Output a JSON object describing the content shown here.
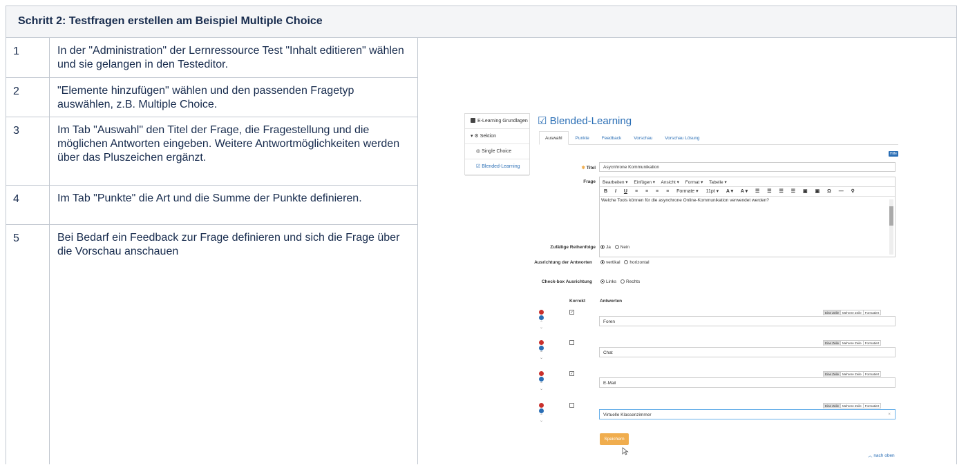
{
  "header": {
    "title": "Schritt 2: Testfragen erstellen am Beispiel Multiple Choice"
  },
  "steps": [
    {
      "num": "1",
      "text": "In der \"Administration\" der Lernressource Test  \"Inhalt editieren\" wählen und sie gelangen in den Testeditor."
    },
    {
      "num": "2",
      "text": "\"Elemente hinzufügen\" wählen und den passenden Fragetyp auswählen, z.B. Multiple Choice."
    },
    {
      "num": "3",
      "text": "Im Tab \"Auswahl\" den Titel der Frage, die Fragestellung und die möglichen Antworten eingeben. Weitere Antwortmöglichkeiten werden über das Pluszeichen ergänzt."
    },
    {
      "num": "4",
      "text": "Im Tab \"Punkte\" die Art und die Summe der Punkte definieren."
    },
    {
      "num": "5",
      "text": "Bei Bedarf ein Feedback zur Frage definieren und sich die Frage über die Vorschau anschauen"
    }
  ],
  "shot": {
    "sidebar": {
      "root": "E-Learning Grundlagen",
      "section": "Sektion",
      "item1": "Single Choice",
      "item2": "Blended-Learning"
    },
    "page_title": "Blended-Learning",
    "tabs": [
      "Auswahl",
      "Punkte",
      "Feedback",
      "Vorschau",
      "Vorschau Lösung"
    ],
    "help": "Hilfe",
    "title_label": "Titel",
    "title_value": "Asycnhrone Kommunikation",
    "question_label": "Frage",
    "editor_menu": [
      "Bearbeiten ▾",
      "Einfügen ▾",
      "Ansicht ▾",
      "Format ▾",
      "Tabelle ▾"
    ],
    "editor_tools": [
      "B",
      "I",
      "U",
      "≡",
      "≡",
      "≡",
      "≡",
      "Formate ▾",
      "11pt ▾",
      "A ▾",
      "A ▾",
      "☰",
      "☰",
      "☰",
      "☰",
      "▣",
      "▣",
      "Ω",
      "—",
      "⚲"
    ],
    "question_text": "Welche Tools können für die asynchrone Online-Kommunikation verwendet werden?",
    "random_label": "Zufällige Reihenfolge",
    "random_yes": "Ja",
    "random_no": "Nein",
    "align_label": "Ausrichtung der Antworten",
    "align_v": "vertikal",
    "align_h": "horizontal",
    "checkbox_label": "Check-box Ausrichtung",
    "checkbox_l": "Links",
    "checkbox_r": "Rechts",
    "col_correct": "Korrekt",
    "col_answers": "Antworten",
    "modes": [
      "Eine Zeile",
      "Mehrere Zeile",
      "Formatiert"
    ],
    "answers": [
      "Foren",
      "Chat",
      "E-Mail",
      "Virtuelle Klassenzimmer"
    ],
    "save": "Speichern",
    "to_top": "nach oben"
  }
}
